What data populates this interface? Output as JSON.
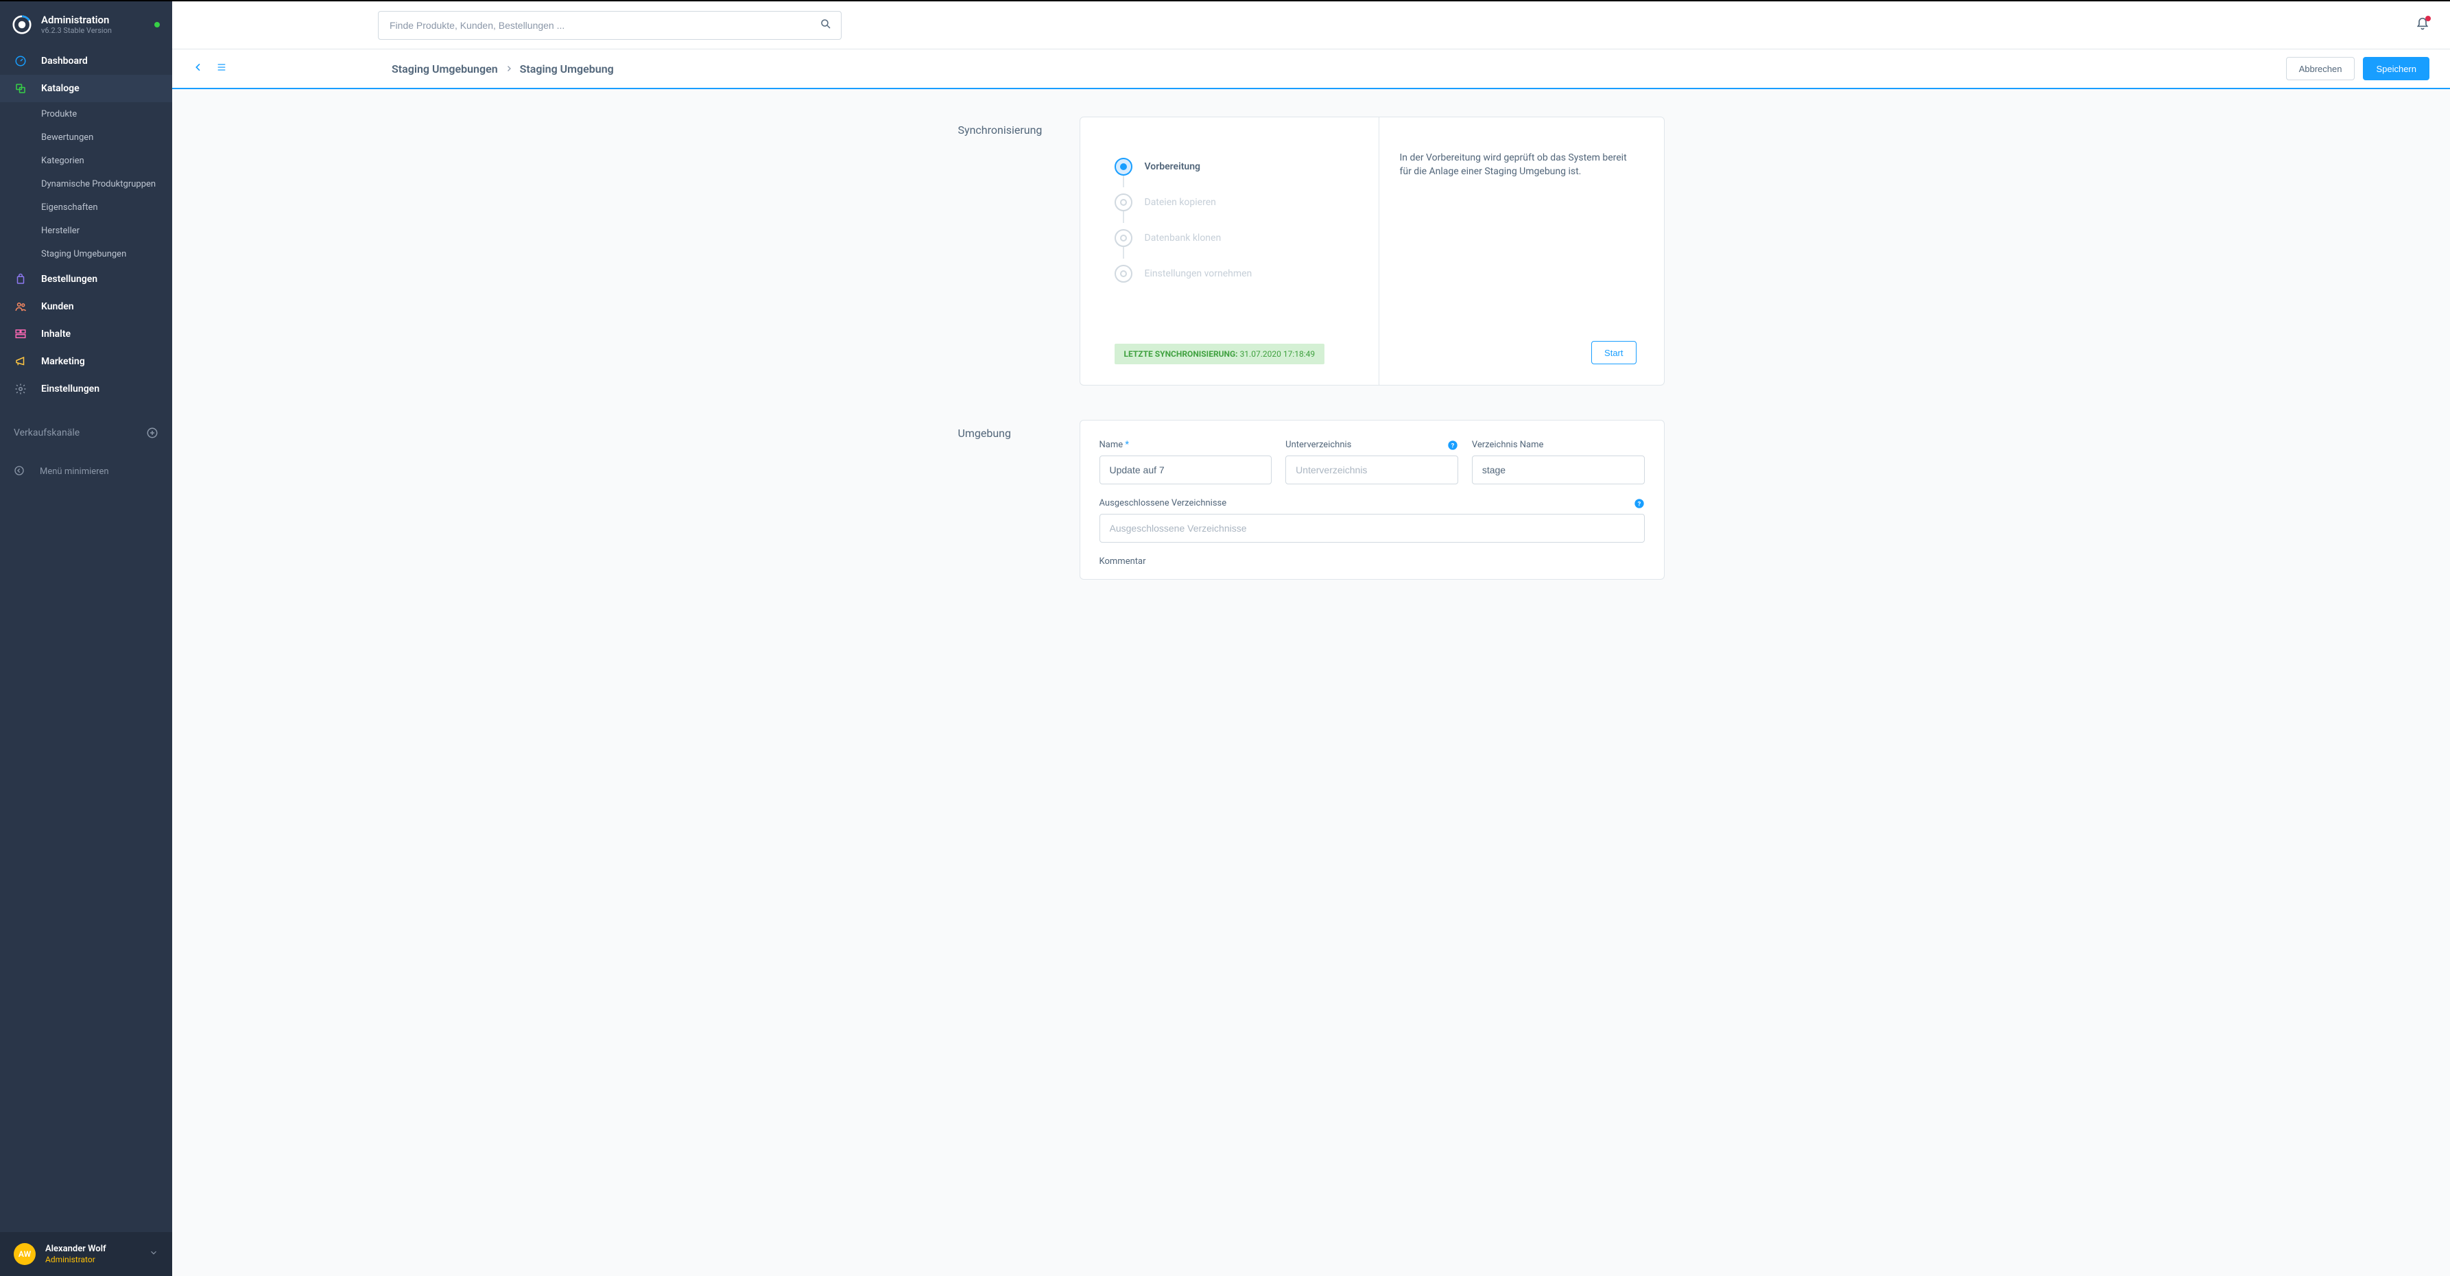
{
  "header": {
    "title": "Administration",
    "version": "v6.2.3 Stable Version"
  },
  "search": {
    "placeholder": "Finde Produkte, Kunden, Bestellungen ..."
  },
  "nav": {
    "dashboard": "Dashboard",
    "kataloge": "Kataloge",
    "sub": {
      "produkte": "Produkte",
      "bewertungen": "Bewertungen",
      "kategorien": "Kategorien",
      "dyn": "Dynamische Produktgruppen",
      "eigenschaften": "Eigenschaften",
      "hersteller": "Hersteller",
      "staging": "Staging Umgebungen"
    },
    "bestellungen": "Bestellungen",
    "kunden": "Kunden",
    "inhalte": "Inhalte",
    "marketing": "Marketing",
    "einstellungen": "Einstellungen",
    "saleschannel": "Verkaufskanäle",
    "minimize": "Menü minimieren"
  },
  "user": {
    "initials": "AW",
    "name": "Alexander Wolf",
    "role": "Administrator"
  },
  "breadcrumb": {
    "a": "Staging Umgebungen",
    "b": "Staging Umgebung"
  },
  "actions": {
    "cancel": "Abbrechen",
    "save": "Speichern"
  },
  "sync": {
    "title": "Synchronisierung",
    "steps": {
      "s1": "Vorbereitung",
      "s2": "Dateien kopieren",
      "s3": "Datenbank klonen",
      "s4": "Einstellungen vornehmen"
    },
    "last_label": "LETZTE SYNCHRONISIERUNG:",
    "last_value": "31.07.2020 17:18:49",
    "desc": "In der Vorbereitung wird geprüft ob das System bereit für die Anlage einer Staging Umgebung ist.",
    "start": "Start"
  },
  "env": {
    "title": "Umgebung",
    "name_label": "Name ",
    "name_value": "Update auf 7",
    "subdir_label": "Unterverzeichnis",
    "subdir_placeholder": "Unterverzeichnis",
    "dirname_label": "Verzeichnis Name",
    "dirname_value": "stage",
    "excluded_label": "Ausgeschlossene Verzeichnisse",
    "excluded_placeholder": "Ausgeschlossene Verzeichnisse",
    "comment_label": "Kommentar"
  },
  "colors": {
    "primary": "#189eff",
    "sidebar": "#2a3649",
    "success": "#37d046"
  }
}
